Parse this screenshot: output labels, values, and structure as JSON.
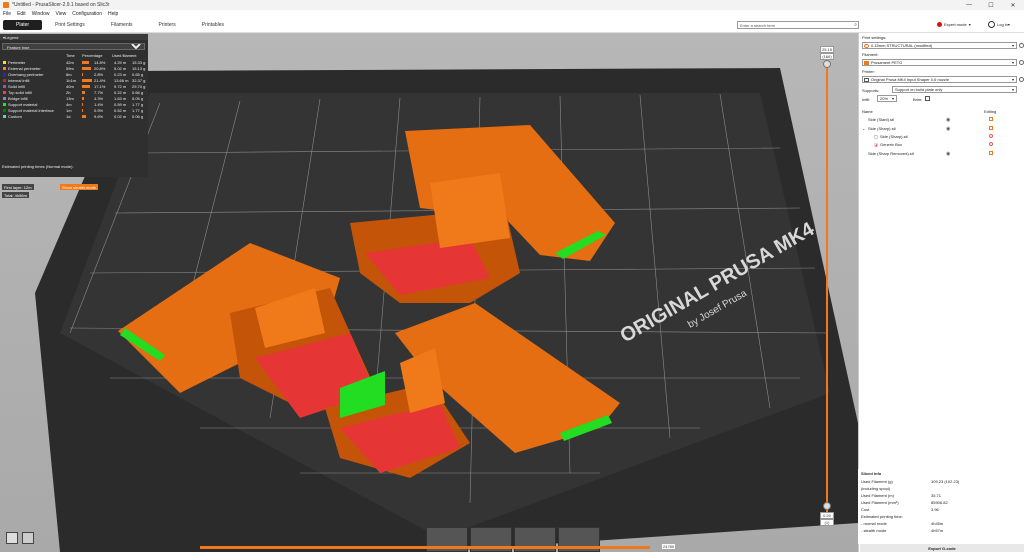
{
  "window": {
    "title": "*Untitled - PrusaSlicer-2.9.1 based on Slic3r",
    "controls": [
      "—",
      "☐",
      "✕"
    ]
  },
  "menu": [
    "File",
    "Edit",
    "Window",
    "View",
    "Configuration",
    "Help"
  ],
  "tabs": [
    "Plater",
    "Print Settings",
    "Filaments",
    "Printers",
    "Printables"
  ],
  "search": {
    "placeholder": "Enter a search term"
  },
  "mode": {
    "label": "Expert mode",
    "color": "#e01010"
  },
  "login": {
    "label": "Log in"
  },
  "bed": {
    "brand": "ORIGINAL PRUSA MK4",
    "sub": "by Josef Prusa"
  },
  "legend": {
    "title": "Legend",
    "view_type": "Feature type",
    "columns": {
      "time": "Time",
      "percentage": "Percentage",
      "used": "Used filament"
    },
    "features": [
      {
        "name": "Perimeter",
        "color": "#ffe500",
        "time": "42m",
        "pct": "14.8%",
        "len": "4.29 m",
        "g": "15.33 g",
        "pct_value": 14.8
      },
      {
        "name": "External perimeter",
        "color": "#ff7d38",
        "time": "59m",
        "pct": "20.8%",
        "len": "5.02 m",
        "g": "15.13 g",
        "pct_value": 20.8
      },
      {
        "name": "Overhang perimeter",
        "color": "#1f1fff",
        "time": "8m",
        "pct": "2.8%",
        "len": "0.23 m",
        "g": "0.65 g",
        "pct_value": 2.8
      },
      {
        "name": "Internal infill",
        "color": "#b03029",
        "time": "1h1m",
        "pct": "21.4%",
        "len": "13.66 m",
        "g": "32.37 g",
        "pct_value": 21.4
      },
      {
        "name": "Solid infill",
        "color": "#9654cc",
        "time": "40m",
        "pct": "17.1%",
        "len": "9.72 m",
        "g": "29.70 g",
        "pct_value": 17.1
      },
      {
        "name": "Top solid infill",
        "color": "#f04040",
        "time": "2h",
        "pct": "7.7%",
        "len": "0.22 m",
        "g": "0.66 g",
        "pct_value": 7.7
      },
      {
        "name": "Bridge infill",
        "color": "#7d8cbc",
        "time": "13m",
        "pct": "4.3%",
        "len": "1.63 m",
        "g": "5.05 g",
        "pct_value": 4.3
      },
      {
        "name": "Support material",
        "color": "#00ff00",
        "time": "4m",
        "pct": "1.4%",
        "len": "0.59 m",
        "g": "1.77 g",
        "pct_value": 1.4
      },
      {
        "name": "Support material interface",
        "color": "#008000",
        "time": "1m",
        "pct": "0.5%",
        "len": "0.52 m",
        "g": "1.77 g",
        "pct_value": 0.5
      },
      {
        "name": "Custom",
        "color": "#5ed9a3",
        "time": "1d",
        "pct": "9.6%",
        "len": "0.02 m",
        "g": "0.06 g",
        "pct_value": 9.6
      }
    ],
    "estimated_title": "Estimated printing times (Normal mode):",
    "first_layer": "First layer: 12m",
    "total": "Total: 4h56m",
    "stealth_button": "Show stealth mode"
  },
  "right": {
    "print_settings_label": "Print settings:",
    "print_settings_value": "0.15mm STRUCTURAL (modified)",
    "filament_label": "Filament:",
    "filament_value": "Prusament PETG",
    "filament_color": "#f07a1a",
    "printer_label": "Printer:",
    "printer_value": "Original Prusa MK4 Input Shaper 0.6 nozzle",
    "supports_label": "Supports:",
    "supports_value": "Support on build plate only",
    "infill_label": "Infill:",
    "infill_value": "20%",
    "brim_label": "Brim:",
    "col_name": "Name",
    "col_editing": "Editing",
    "objects": [
      "Side (Slant).stl",
      "Side (Sharp).stl",
      "Side (Sharp).stl",
      "Generic Box",
      "Side (Sharp Removed).stl"
    ]
  },
  "sliced": {
    "title": "Sliced Info",
    "rows": [
      {
        "k": "Used Filament (g)",
        "v": "109.23 (102.23)"
      },
      {
        "k": "(including spool)",
        "v": ""
      },
      {
        "k": "Used Filament (m)",
        "v": "35.71"
      },
      {
        "k": "Used Filament (mm³)",
        "v": "85906.82"
      },
      {
        "k": "Cost",
        "v": "3.96"
      },
      {
        "k": "Estimated printing time:",
        "v": ""
      },
      {
        "k": "- normal mode",
        "v": "4h45m"
      },
      {
        "k": "- stealth mode",
        "v": "4h57m"
      }
    ],
    "export": "Export G-code"
  },
  "vslider": {
    "top": "25.15",
    "top2": "(166)",
    "bottom": "0.20",
    "bottom2": "(1)"
  },
  "hslider": {
    "label": "24780"
  }
}
